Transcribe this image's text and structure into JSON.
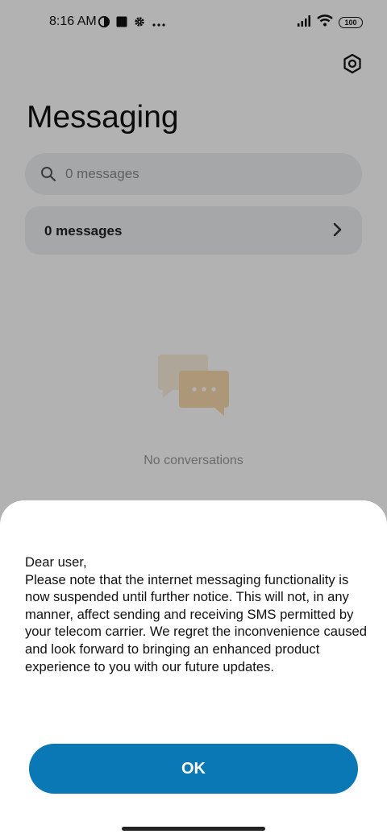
{
  "status_bar": {
    "time": "8:16 AM",
    "battery": "100"
  },
  "icons": {
    "settings": "gear-hexagon-icon",
    "search": "search-icon",
    "chevron": "chevron-right-icon",
    "empty": "chat-bubbles-icon"
  },
  "header": {
    "title": "Messaging"
  },
  "search": {
    "placeholder": "0 messages"
  },
  "messages_row": {
    "label": "0 messages"
  },
  "empty_state": {
    "text": "No conversations"
  },
  "dialog": {
    "message": "Dear user,\nPlease note that the internet messaging functionality is now suspended until further notice. This will not, in any manner, affect sending and receiving SMS permitted by your telecom carrier. We regret the inconvenience caused and look forward to bringing an enhanced product experience to you with our future updates.",
    "ok_label": "OK"
  },
  "colors": {
    "accent": "#0a78b4",
    "surface": "#eceff1"
  }
}
